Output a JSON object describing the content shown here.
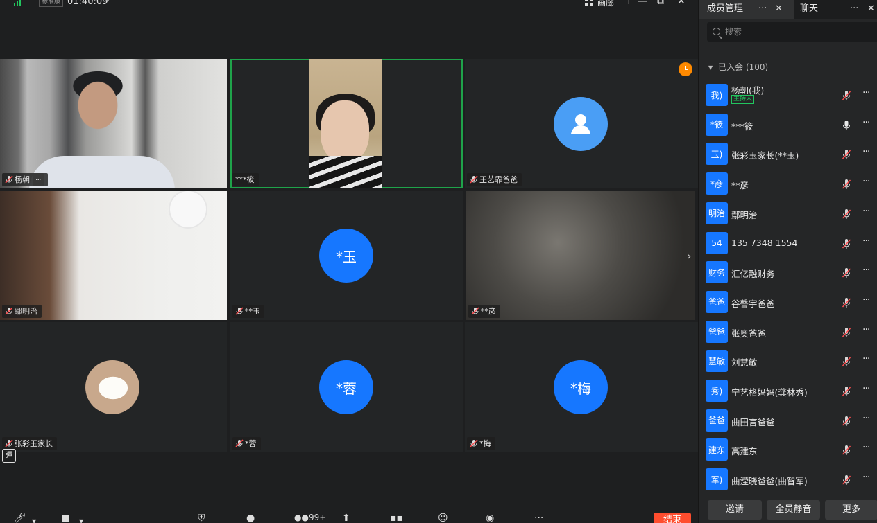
{
  "topbar": {
    "quality": "标准版",
    "timer": "01:40:09",
    "layout_label": "画廊"
  },
  "tiles": [
    {
      "label": "杨朝",
      "muted": true,
      "has_more": true,
      "kind": "video-office"
    },
    {
      "label": "***筱",
      "muted": false,
      "kind": "video-woman",
      "active": true
    },
    {
      "label": "王艺霏爸爸",
      "muted": true,
      "kind": "avatar-default"
    },
    {
      "label": "鄢明治",
      "muted": true,
      "kind": "video-wall"
    },
    {
      "label": "**玉",
      "muted": true,
      "kind": "avatar",
      "avatar_text": "*玉"
    },
    {
      "label": "**彦",
      "muted": true,
      "kind": "video-blur"
    },
    {
      "label": "张彩玉家长",
      "muted": true,
      "kind": "avatar-cat"
    },
    {
      "label": "*蓉",
      "muted": true,
      "kind": "avatar",
      "avatar_text": "*蓉"
    },
    {
      "label": "*梅",
      "muted": true,
      "kind": "avatar",
      "avatar_text": "*梅"
    }
  ],
  "panel": {
    "tab_members": "成员管理",
    "tab_chat": "聊天",
    "search_placeholder": "搜索",
    "group_header": "已入会 (100)",
    "host_role": "主持人",
    "members": [
      {
        "avatar": "我)",
        "name": "杨朝(我)",
        "role": true,
        "mic": "muted"
      },
      {
        "avatar": "*筱",
        "name": "***筱",
        "mic": "on"
      },
      {
        "avatar": "玉)",
        "name": "张彩玉家长(**玉)",
        "mic": "muted"
      },
      {
        "avatar": "*彦",
        "name": "**彦",
        "mic": "muted"
      },
      {
        "avatar": "明治",
        "name": "鄢明治",
        "mic": "muted"
      },
      {
        "avatar": "54",
        "name": "135 7348 1554",
        "mic": "muted"
      },
      {
        "avatar": "财务",
        "name": "汇亿融财务",
        "mic": "muted"
      },
      {
        "avatar": "爸爸",
        "name": "谷謦宇爸爸",
        "mic": "muted"
      },
      {
        "avatar": "爸爸",
        "name": "张奥爸爸",
        "mic": "muted"
      },
      {
        "avatar": "慧敏",
        "name": "刘慧敏",
        "mic": "muted"
      },
      {
        "avatar": "秀)",
        "name": "宁艺格妈妈(龚林秀)",
        "mic": "muted"
      },
      {
        "avatar": "爸爸",
        "name": "曲田言爸爸",
        "mic": "muted"
      },
      {
        "avatar": "建东",
        "name": "高建东",
        "mic": "muted"
      },
      {
        "avatar": "军)",
        "name": "曲滢晓爸爸(曲智军)",
        "mic": "muted"
      }
    ],
    "footer": {
      "invite": "邀请",
      "mute_all": "全员静音",
      "more": "更多"
    }
  },
  "bottombar": {
    "participants_count": "99+",
    "end_label": "结束"
  },
  "colors": {
    "accent": "#1677ff",
    "active_border": "#1fa34a",
    "end": "#ff4d2e",
    "host": "#22c55e"
  }
}
